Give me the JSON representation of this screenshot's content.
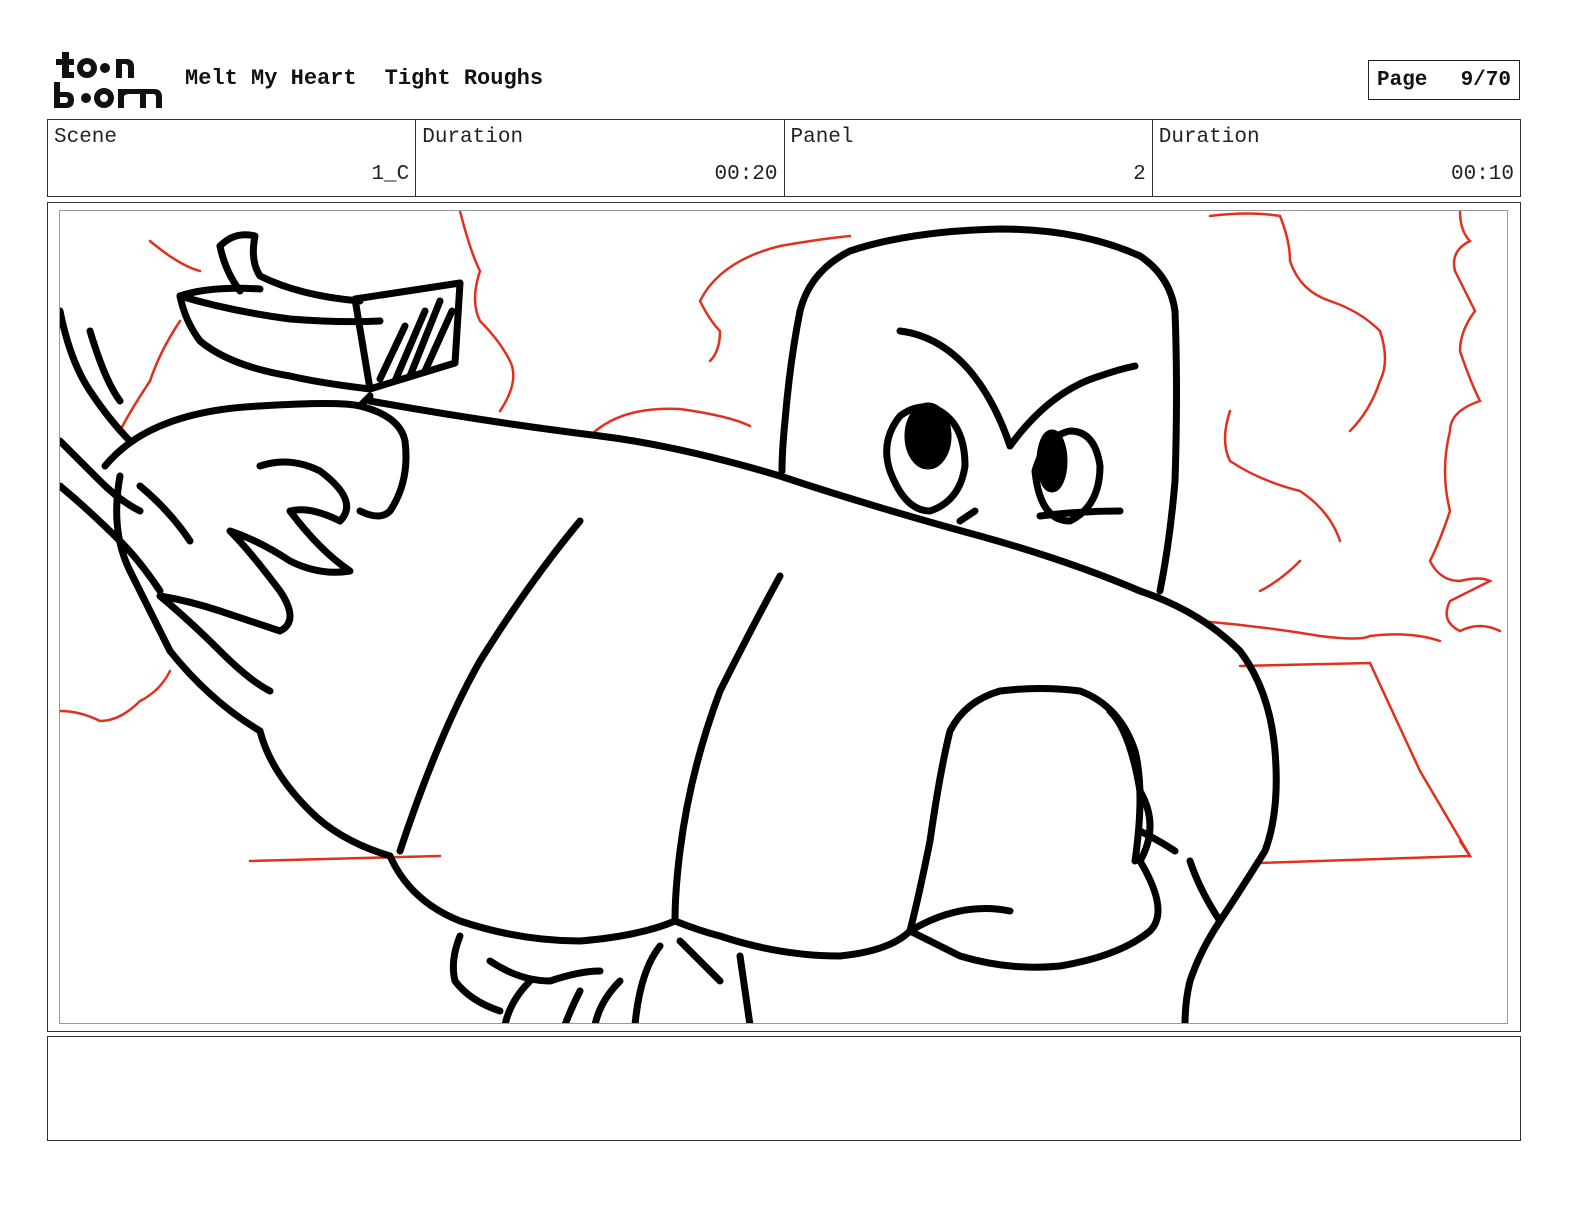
{
  "header": {
    "logo_text": "toon boom",
    "project_title": "Melt My Heart",
    "stage": "Tight Roughs",
    "page_label": "Page",
    "page_number": "9/70"
  },
  "info": {
    "scene_label": "Scene",
    "scene_value": "1_C",
    "scene_duration_label": "Duration",
    "scene_duration_value": "00:20",
    "panel_label": "Panel",
    "panel_value": "2",
    "panel_duration_label": "Duration",
    "panel_duration_value": "00:10"
  },
  "panel": {
    "description": "Rough storyboard sketch: a large fist in the foreground, a character glaring angrily behind it"
  },
  "notes": {
    "text": ""
  },
  "colors": {
    "ink": "#000000",
    "layout_red": "#e0301e",
    "frame_border": "#333333"
  }
}
